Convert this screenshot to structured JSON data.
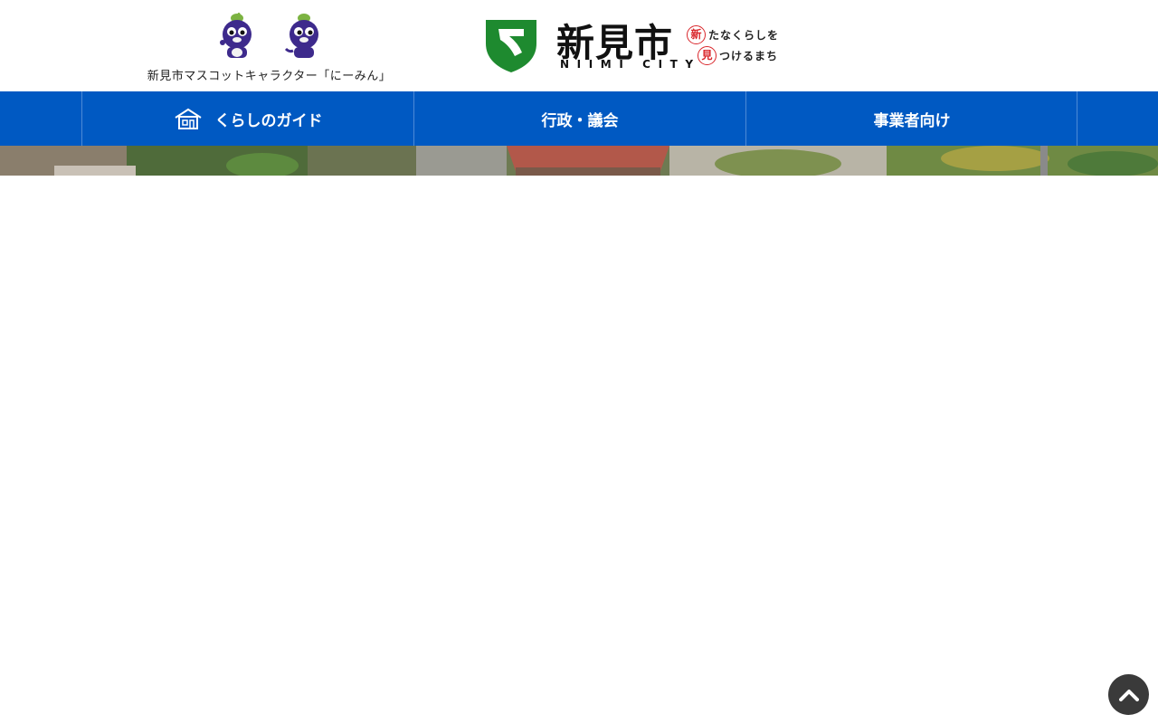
{
  "header": {
    "mascot_caption": "新見市マスコットキャラクター「にーみん」",
    "logo_name": "新見市",
    "logo_roman": "NIIMI CITY",
    "slogan_line1_mark": "新",
    "slogan_line1_text": "たなくらしを",
    "slogan_line2_mark": "見",
    "slogan_line2_text": "つけるまち"
  },
  "nav": {
    "items": [
      {
        "label": "くらしのガイド",
        "icon": "house-icon"
      },
      {
        "label": "行政・議会"
      },
      {
        "label": "事業者向け"
      }
    ]
  },
  "page_top": {
    "icon": "chevron-up-icon"
  },
  "colors": {
    "nav_bg": "#0059c2",
    "logo_green": "#1e8a2f",
    "slogan_red": "#d9262b",
    "mascot_purple": "#3d2a8c",
    "page_top_bg": "#3a3a3a"
  }
}
